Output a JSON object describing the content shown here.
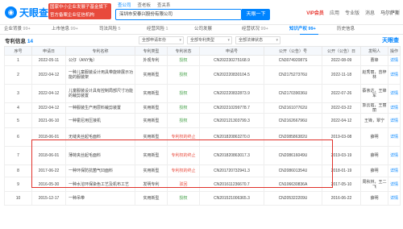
{
  "header": {
    "logo_text": "天眼查",
    "promo_lines": [
      "国家中小企业发展子基金旗下",
      "官方备案企业征信机构"
    ],
    "search_tabs": [
      "查公司",
      "查老板",
      "查关系"
    ],
    "search_value": "深圳市安泰兴股份有限公司",
    "search_button": "天眼一下",
    "right_items": [
      "VIP会员",
      "应用",
      "专业版",
      "消息"
    ],
    "user_name": "马尔萨斯"
  },
  "nav": [
    {
      "label": "企业背景",
      "count": "99+",
      "active": false
    },
    {
      "label": "上市信息",
      "count": "99+",
      "active": false
    },
    {
      "label": "司法风险",
      "count": "5",
      "active": false
    },
    {
      "label": "经营风险",
      "count": "1",
      "active": false
    },
    {
      "label": "公司发展",
      "count": "",
      "active": false
    },
    {
      "label": "经营状况",
      "count": "99+",
      "active": false
    },
    {
      "label": "知识产权",
      "count": "99+",
      "active": true
    },
    {
      "label": "历史信息",
      "count": "",
      "active": false
    }
  ],
  "section": {
    "title": "专利信息",
    "count": "14",
    "filters": [
      "全部申请年份",
      "全部专利类型",
      "全部法律状态"
    ],
    "brand": "天眼查"
  },
  "table": {
    "headers": [
      "序号",
      "申请日",
      "专利名称",
      "专利类型",
      "专利状态",
      "申请号",
      "公开（公告）号",
      "公开（公告）日",
      "发明人",
      "操作"
    ],
    "action_label": "详情",
    "rows": [
      {
        "no": "1",
        "date": "2022-05-11",
        "name": "公仔（ANY兔）",
        "type": "外观专利",
        "status": "授权",
        "app_no": "CN202230275168.9",
        "pub_no": "CN307492087S",
        "pub_date": "2022-08-09",
        "inventor": "曹锋"
      },
      {
        "no": "2",
        "date": "2022-04-12",
        "name": "一种儿童服装设计用具带旋转展示功能的服装架",
        "type": "实用新型",
        "status": "授权",
        "app_no": "CN202220830104.5",
        "pub_no": "CN217527376U",
        "pub_date": "2022-11-18",
        "inventor": "赵秀丽，曾梓林"
      },
      {
        "no": "3",
        "date": "2022-04-12",
        "name": "儿童服装设计具有控制局部尺寸功能的裁剪装置",
        "type": "实用新型",
        "status": "授权",
        "app_no": "CN202220832873.9",
        "pub_no": "CN217039036U",
        "pub_date": "2022-07-26",
        "inventor": "蔡亲达，王锋军"
      },
      {
        "no": "4",
        "date": "2022-04-12",
        "name": "一种服装生产用层料裁剪装置",
        "type": "实用新型",
        "status": "授权",
        "app_no": "CN202210299778.7",
        "pub_no": "CN216107762U",
        "pub_date": "2022-03-22",
        "inventor": "郭云霞，王丽丽"
      },
      {
        "no": "5",
        "date": "2021-06-10",
        "name": "一种霍尼用压接机",
        "type": "实用新型",
        "status": "授权",
        "app_no": "CN202121303799.3",
        "pub_no": "CN216266796U",
        "pub_date": "2022-04-12",
        "inventor": "王锋，覃宁"
      },
      {
        "no": "6",
        "date": "2018-06-01",
        "name": "无缝夹丝起毛面料",
        "type": "实用新型",
        "status": "专利权的终止",
        "app_no": "CN201820863270.0",
        "pub_no": "CN208586382U",
        "pub_date": "2019-03-08",
        "inventor": "薛明"
      },
      {
        "no": "7",
        "date": "2018-06-01",
        "name": "薄荷夹丝起毛面料",
        "type": "实用新型",
        "status": "专利权的终止",
        "app_no": "CN201820863017.3",
        "pub_no": "CN208616049U",
        "pub_date": "2019-03-19",
        "inventor": "薛明"
      },
      {
        "no": "8",
        "date": "2017-06-22",
        "name": "一种环保防抗菌气凹面料",
        "type": "实用新型",
        "status": "专利权的终止",
        "app_no": "CN201720732941.3",
        "pub_no": "CN208601354U",
        "pub_date": "2018-01-19",
        "inventor": "薛明"
      },
      {
        "no": "9",
        "date": "2016-05-30",
        "name": "一种水溶环保染色工艺及机布工艺",
        "type": "发明专利",
        "status": "驳回",
        "app_no": "CN201611236670.7",
        "pub_no": "CN106630836A",
        "pub_date": "2017-05-10",
        "inventor": "周秋林，王二飞"
      },
      {
        "no": "10",
        "date": "2015-12-17",
        "name": "一种吊带",
        "type": "实用新型",
        "status": "授权",
        "app_no": "CN201521006365.3",
        "pub_no": "CN205322209U",
        "pub_date": "2016-06-22",
        "inventor": "薛明"
      }
    ]
  },
  "colors": {
    "accent": "#0084ff",
    "granted": "#3a9b3e",
    "terminated": "#e84a3c",
    "highlight": "#e0312b"
  }
}
